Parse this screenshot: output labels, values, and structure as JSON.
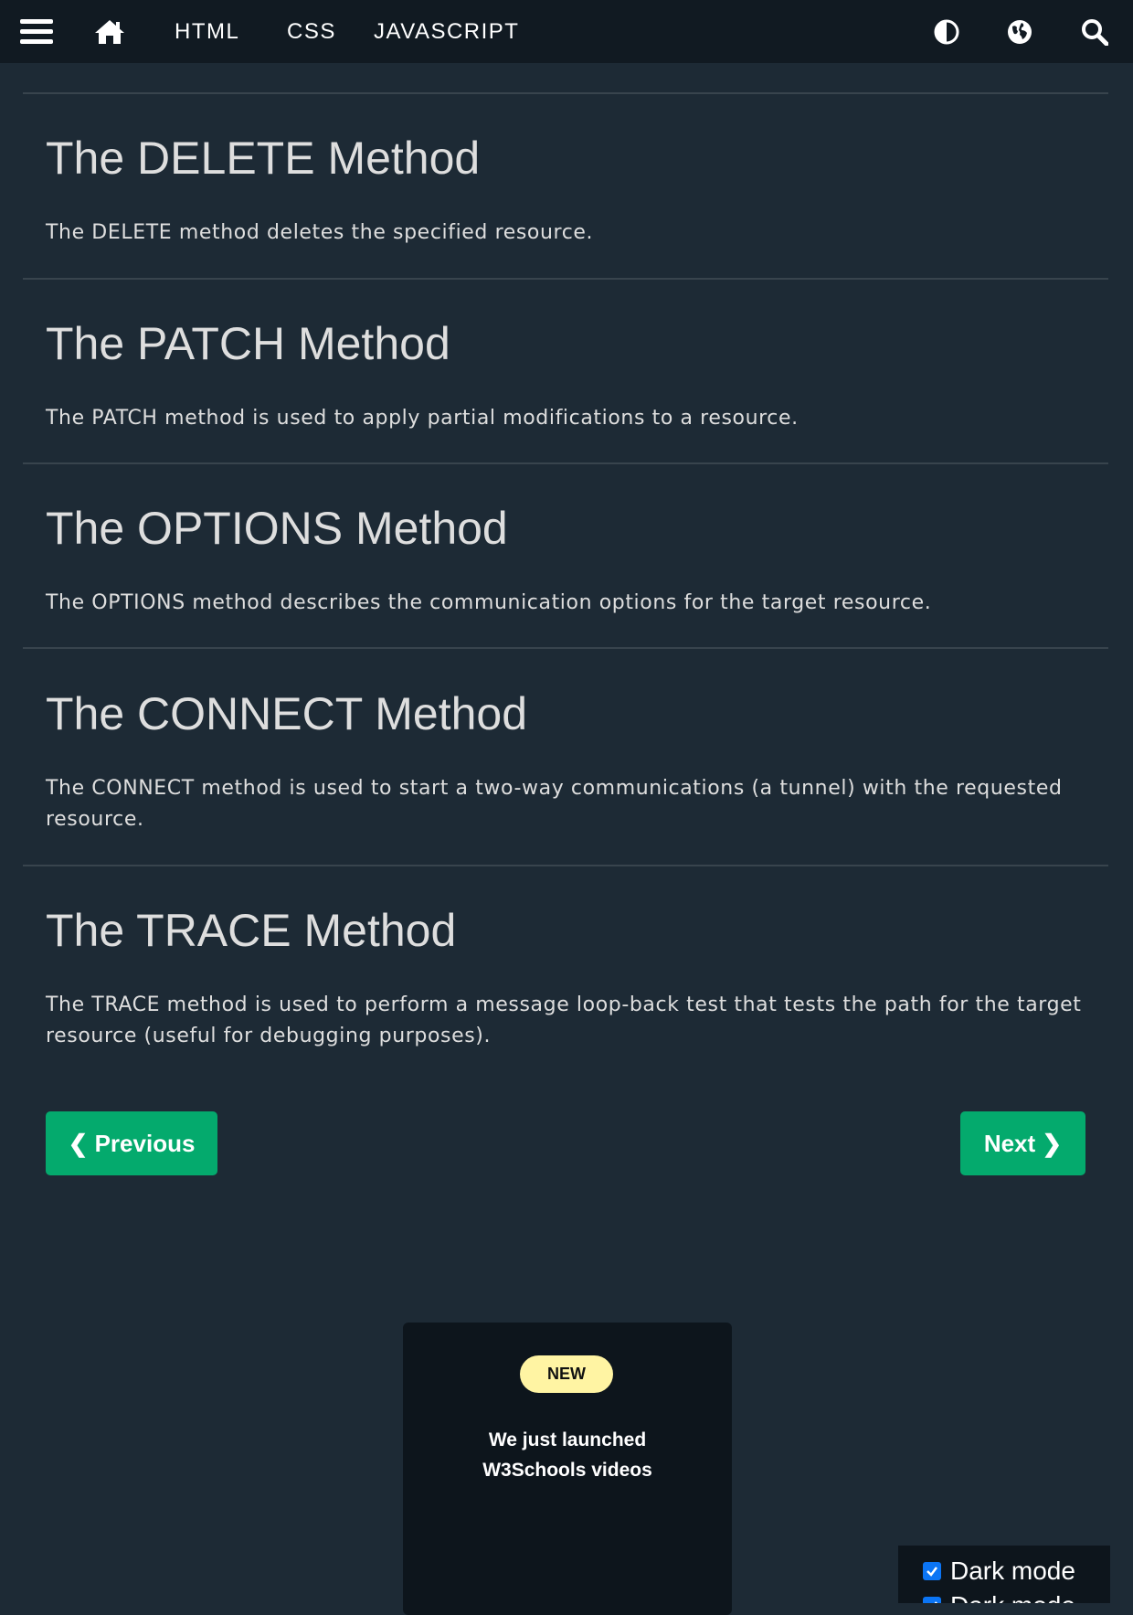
{
  "nav": {
    "menu_icon": "menu-icon",
    "home_icon": "home-icon",
    "links": [
      "HTML",
      "CSS",
      "JAVASCRIPT"
    ],
    "contrast_icon": "contrast-icon",
    "globe_icon": "globe-icon",
    "search_icon": "search-icon"
  },
  "sections": [
    {
      "heading": "The DELETE Method",
      "text": "The DELETE method deletes the specified resource."
    },
    {
      "heading": "The PATCH Method",
      "text": "The PATCH method is used to apply partial modifications to a resource."
    },
    {
      "heading": "The OPTIONS Method",
      "text": "The OPTIONS method describes the communication options for the target resource."
    },
    {
      "heading": "The CONNECT Method",
      "text": "The CONNECT method is used to start a two-way communications (a tunnel) with the requested resource."
    },
    {
      "heading": "The TRACE Method",
      "text": "The TRACE method is used to perform a message loop-back test that tests the path for the target resource (useful for debugging purposes)."
    }
  ],
  "pager": {
    "previous_label": "❮ Previous",
    "next_label": "Next ❯"
  },
  "promo": {
    "badge": "NEW",
    "line1": "We just launched",
    "line2": "W3Schools videos"
  },
  "dark_mode": {
    "label": "Dark mode",
    "checked": true
  },
  "colors": {
    "background": "#1d2a35",
    "nav_background": "#111a22",
    "button_green": "#04aa6d",
    "badge_yellow": "#fff4a3"
  }
}
